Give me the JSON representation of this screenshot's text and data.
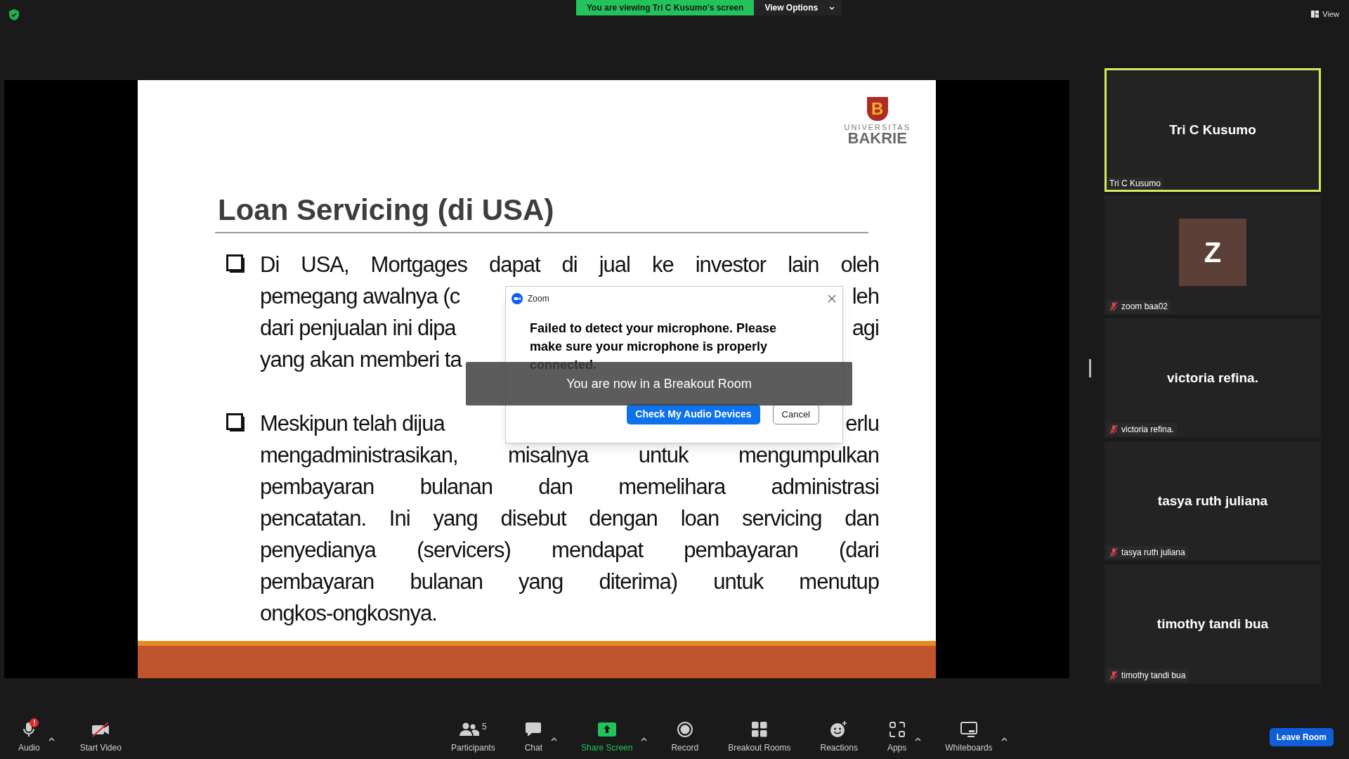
{
  "top_bar": {
    "viewing_label": "You are viewing Tri C Kusumo's screen",
    "view_options": "View Options",
    "view_button": "View"
  },
  "slide": {
    "logo": {
      "mark": "B",
      "line1": "UNIVERSITAS",
      "line2": "BAKRIE"
    },
    "title": "Loan Servicing (di USA)",
    "bullets": [
      {
        "lines": [
          {
            "kind": "justify",
            "text": "Di USA, Mortgages dapat di jual ke investor lain oleh"
          },
          {
            "kind": "split",
            "left": "pemegang awalnya (c",
            "right": "leh"
          },
          {
            "kind": "split",
            "left": "dari penjualan ini dipa",
            "right": "agi"
          },
          {
            "kind": "end",
            "text": "yang akan memberi ta"
          }
        ]
      },
      {
        "lines": [
          {
            "kind": "split",
            "left": "Meskipun telah dijua",
            "right": "erlu"
          },
          {
            "kind": "justify",
            "text": "mengadministrasikan, misalnya untuk mengumpulkan"
          },
          {
            "kind": "justify",
            "text": "pembayaran bulanan dan memelihara administrasi"
          },
          {
            "kind": "justify",
            "text": "pencatatan. Ini yang disebut dengan loan servicing dan"
          },
          {
            "kind": "justify",
            "text": "penyedianya (servicers) mendapat pembayaran (dari"
          },
          {
            "kind": "justify",
            "text": "pembayaran bulanan yang diterima) untuk menutup"
          },
          {
            "kind": "end",
            "text": "ongkos-ongkosnya."
          }
        ]
      }
    ]
  },
  "dialog": {
    "title": "Zoom",
    "message": "Failed to detect your microphone. Please make sure your microphone is properly connected.",
    "primary_button": "Check My Audio Devices",
    "secondary_button": "Cancel"
  },
  "notification": "You are now in a Breakout Room",
  "participants": [
    {
      "name": "Tri C Kusumo",
      "label": "Tri C Kusumo",
      "muted": false,
      "active": true
    },
    {
      "avatar": "Z",
      "label": "zoom baa02",
      "muted": true,
      "active": false
    },
    {
      "name": "victoria refina.",
      "label": "victoria refina.",
      "muted": true,
      "active": false
    },
    {
      "name": "tasya ruth juliana",
      "label": "tasya ruth juliana",
      "muted": true,
      "active": false
    },
    {
      "name": "timothy tandi bua",
      "label": "timothy tandi bua",
      "muted": true,
      "active": false
    }
  ],
  "toolbar": {
    "left": [
      {
        "kind": "audio",
        "label": "Audio",
        "badge": "!",
        "caret": true
      },
      {
        "kind": "video",
        "label": "Start Video",
        "caret": false
      }
    ],
    "center": [
      {
        "kind": "participants",
        "label": "Participants",
        "count": "5",
        "caret": false
      },
      {
        "kind": "chat",
        "label": "Chat",
        "caret": true
      },
      {
        "kind": "share",
        "label": "Share Screen",
        "caret": true
      },
      {
        "kind": "record",
        "label": "Record",
        "caret": false
      },
      {
        "kind": "breakout",
        "label": "Breakout Rooms",
        "caret": false
      },
      {
        "kind": "reactions",
        "label": "Reactions",
        "caret": false
      },
      {
        "kind": "apps",
        "label": "Apps",
        "caret": true
      },
      {
        "kind": "whiteboards",
        "label": "Whiteboards",
        "caret": true
      }
    ],
    "leave_button": "Leave Room"
  }
}
